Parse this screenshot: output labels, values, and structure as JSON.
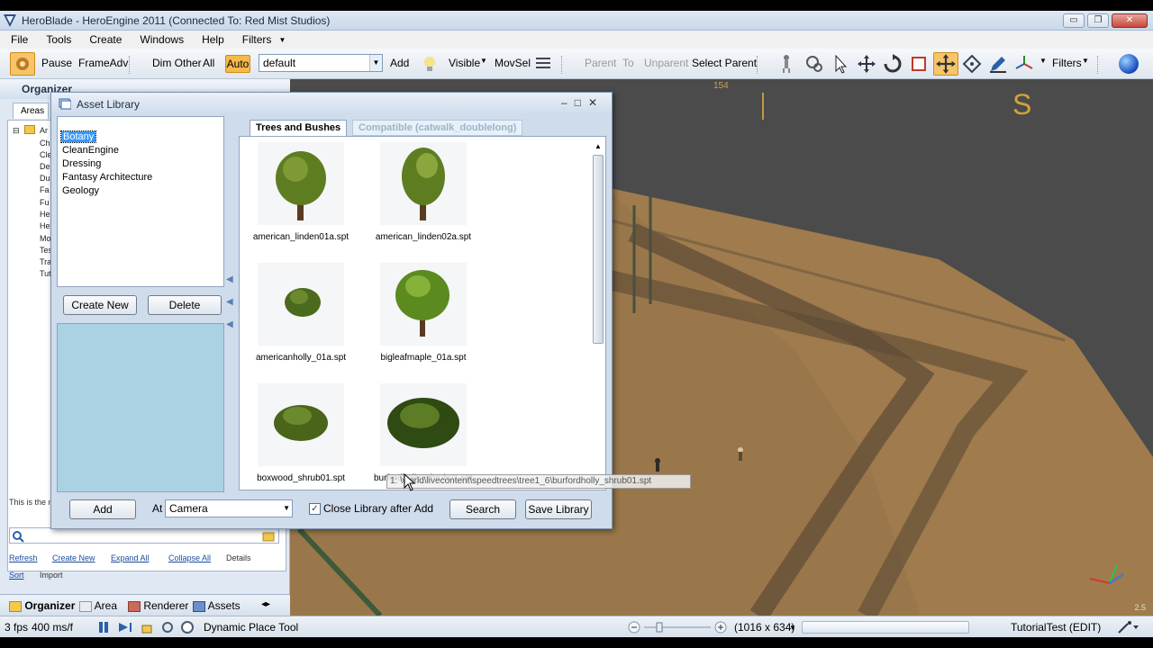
{
  "window": {
    "title": "HeroBlade - HeroEngine 2011 (Connected To: Red Mist Studios)",
    "controls": [
      "▭",
      "❐",
      "✕"
    ]
  },
  "menu": [
    "File",
    "Tools",
    "Create",
    "Windows",
    "Help",
    "Filters"
  ],
  "toolbar": {
    "pause": "Pause",
    "frame_adv": "FrameAdv",
    "dim_other": "Dim Other",
    "all": "All",
    "auto": "Auto",
    "profile_value": "default",
    "add": "Add",
    "visible": "Visible",
    "movsel": "MovSel",
    "parent": "Parent",
    "to": "To",
    "unparent": "Unparent",
    "select_parent": "Select Parent",
    "filters": "Filters"
  },
  "organizer": {
    "title": "Organizer",
    "tab": "Areas",
    "tree_items": [
      "Ar",
      "Ch",
      "Cle",
      "De",
      "Du",
      "Fa",
      "Fu",
      "He",
      "He",
      "Mo",
      "Tes",
      "Tra",
      "Tut"
    ],
    "description": "This is the m",
    "links": [
      "Refresh",
      "Create New",
      "Expand All",
      "Collapse All",
      "Details",
      "Sort",
      "Import"
    ],
    "bottom_tabs": [
      "Organizer",
      "Area",
      "Renderer",
      "Assets"
    ]
  },
  "dialog": {
    "title": "Asset Library",
    "categories": [
      "Botany",
      "CleanEngine",
      "Dressing",
      "Fantasy Architecture",
      "Geology"
    ],
    "selected_category": "Botany",
    "create_new": "Create New",
    "delete": "Delete",
    "tabs": [
      "Trees and Bushes",
      "Compatible (catwalk_doublelong)"
    ],
    "assets": [
      {
        "label": "american_linden01a.spt",
        "shape": "tree-tall"
      },
      {
        "label": "american_linden02a.spt",
        "shape": "tree-tall"
      },
      {
        "label": "americanholly_01a.spt",
        "shape": "bush-small"
      },
      {
        "label": "bigleafmaple_01a.spt",
        "shape": "tree-round"
      },
      {
        "label": "boxwood_shrub01.spt",
        "shape": "bush-mid"
      },
      {
        "label": "burfordholly_shrub01.spt",
        "shape": "bush-wide"
      }
    ],
    "tooltip": "1: \\world\\livecontent\\speedtrees\\tree1_6\\burfordholly_shrub01.spt",
    "add": "Add",
    "at_label": "At",
    "at_value": "Camera",
    "close_after_add": "Close Library after Add",
    "close_after_add_checked": true,
    "search": "Search",
    "save_library": "Save Library"
  },
  "viewport": {
    "letter": "S",
    "number": "154",
    "scale": "2.5"
  },
  "status": {
    "fps": "3 fps",
    "ms": "400 ms/f",
    "tool": "Dynamic Place Tool",
    "resolution": "(1016 x 634)",
    "session": "TutorialTest (EDIT)"
  },
  "colors": {
    "accent_orange": "#f6b94b",
    "selection_blue": "#3399ff",
    "ground": "#9d7a4c",
    "drop_area": "#aad2e3"
  }
}
